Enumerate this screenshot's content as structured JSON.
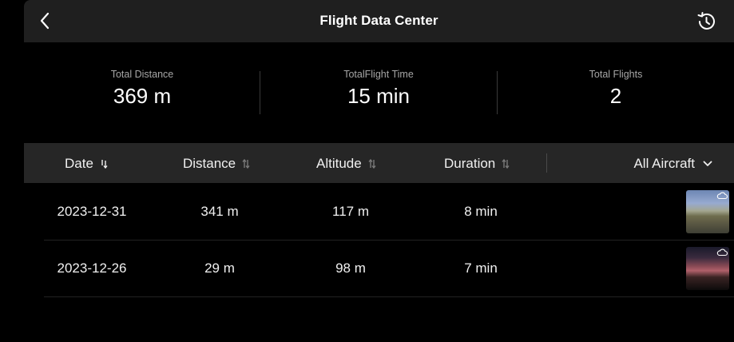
{
  "header": {
    "title": "Flight Data Center",
    "back_icon": "chevron-left-icon",
    "history_icon": "history-icon"
  },
  "stats": [
    {
      "label": "Total Distance",
      "value": "369 m"
    },
    {
      "label": "TotalFlight Time",
      "value": "15 min"
    },
    {
      "label": "Total Flights",
      "value": "2"
    }
  ],
  "table": {
    "columns": [
      "Date",
      "Distance",
      "Altitude",
      "Duration"
    ],
    "filter_label": "All Aircraft",
    "rows": [
      {
        "date": "2023-12-31",
        "distance": "341 m",
        "altitude": "117 m",
        "duration": "8 min",
        "weather_icon": "cloud-icon"
      },
      {
        "date": "2023-12-26",
        "distance": "29 m",
        "altitude": "98 m",
        "duration": "7 min",
        "weather_icon": "cloud-icon"
      }
    ]
  },
  "colors": {
    "background": "#000000",
    "header_bar": "#1f1f1f",
    "table_header": "#262626",
    "label_grey": "#a6a6a6",
    "text": "#ffffff"
  }
}
